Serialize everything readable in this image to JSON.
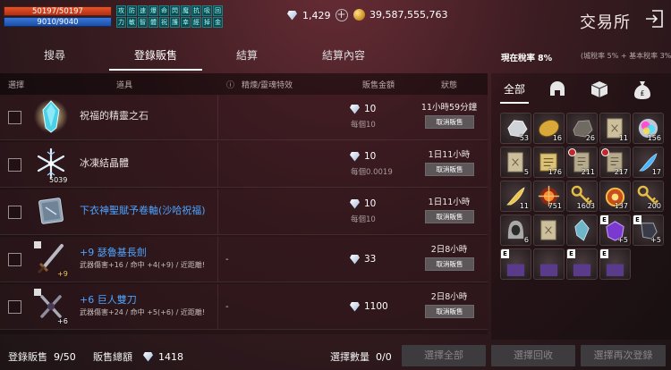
{
  "player": {
    "hp": "50197/50197",
    "mp": "9010/9040"
  },
  "buffs": [
    "攻",
    "防",
    "速",
    "爆",
    "命",
    "閃",
    "魔",
    "抗",
    "吸",
    "回",
    "力",
    "敏",
    "智",
    "體",
    "祝",
    "護",
    "幸",
    "經",
    "掉",
    "金"
  ],
  "currency": {
    "diamonds": "1,429",
    "gold": "39,587,555,763"
  },
  "shop": {
    "title": "交易所"
  },
  "tabs": [
    "搜尋",
    "登錄販售",
    "結算",
    "結算內容"
  ],
  "active_tab": "登錄販售",
  "tax": {
    "label": "現在稅率",
    "value": "8%",
    "detail": "(城稅率 5% + 基本稅率 3%)"
  },
  "table": {
    "headers": {
      "select": "選擇",
      "item": "道具",
      "refine": "精煉/靈魂特效",
      "price": "販售金額",
      "status": "狀態"
    },
    "rows": [
      {
        "name": "祝福的精靈之石",
        "name_color": "white",
        "qty": "",
        "refine": "",
        "price": "10",
        "unit": "每個10",
        "time": "11小時59分鐘",
        "action": "取消販售"
      },
      {
        "name": "冰凍結晶體",
        "name_color": "white",
        "qty": "5039",
        "refine": "",
        "price": "10",
        "unit": "每個0.0019",
        "time": "1日11小時",
        "action": "取消販售"
      },
      {
        "name": "下衣神聖賦予卷軸(沙哈祝福)",
        "name_color": "blue",
        "qty": "",
        "refine": "",
        "price": "10",
        "unit": "每個10",
        "time": "1日11小時",
        "action": "取消販售"
      },
      {
        "name": "+9 瑟魯基長劍",
        "name_color": "blue",
        "qty": "+9",
        "sub": "武器傷害+16 / 命中 +4(+9) / 近距離!",
        "refine": "-",
        "price": "33",
        "unit": "",
        "time": "2日8小時",
        "action": "取消販售"
      },
      {
        "name": "+6 巨人雙刀",
        "name_color": "blue",
        "qty": "+6",
        "sub": "武器傷害+24 / 命中 +5(+6) / 近距離!",
        "refine": "-",
        "price": "1100",
        "unit": "",
        "time": "2日8小時",
        "action": "取消販售"
      }
    ]
  },
  "footer": {
    "registered_label": "登錄販售",
    "registered_value": "9/50",
    "total_label": "販售總額",
    "total_value": "1418",
    "selected_label": "選擇數量",
    "selected_value": "0/0",
    "btn_select_all": "選擇全部",
    "btn_select_reclaim": "選擇回收",
    "btn_select_relist": "選擇再次登錄"
  },
  "inventory": {
    "tabs": [
      "全部",
      "helmet-icon",
      "box-icon",
      "money-bag-icon"
    ],
    "slots": [
      {
        "count": "53",
        "kind": "stone"
      },
      {
        "count": "16",
        "kind": "gold-ore"
      },
      {
        "count": "26",
        "kind": "dark-ore"
      },
      {
        "count": "11",
        "kind": "scroll"
      },
      {
        "count": "",
        "kind": "empty"
      },
      {
        "count": "156",
        "kind": "orb"
      },
      {
        "count": "5",
        "kind": "scroll"
      },
      {
        "count": "176",
        "kind": "scroll-gold"
      },
      {
        "count": "211",
        "kind": "scroll-ban"
      },
      {
        "count": "",
        "kind": "empty"
      },
      {
        "count": "217",
        "kind": "scroll-ban"
      },
      {
        "count": "17",
        "kind": "blue-feather"
      },
      {
        "count": "11",
        "kind": "gold-feather"
      },
      {
        "count": "751",
        "kind": "red-orb"
      },
      {
        "count": "",
        "kind": "empty"
      },
      {
        "count": "1603",
        "kind": "key"
      },
      {
        "count": "137",
        "kind": "amulet"
      },
      {
        "count": "200",
        "kind": "key"
      },
      {
        "count": "6",
        "kind": "hood"
      },
      {
        "count": "",
        "kind": "empty"
      },
      {
        "count": "",
        "kind": "scroll"
      },
      {
        "count": "",
        "kind": "crystal"
      },
      {
        "count": "+5",
        "kind": "purple-armor",
        "e": "E"
      },
      {
        "count": "+5",
        "kind": "dark-gauntlet",
        "e": "E"
      },
      {
        "count": "",
        "kind": "empty"
      },
      {
        "count": "",
        "kind": "partial",
        "e": "E"
      },
      {
        "count": "",
        "kind": "partial"
      },
      {
        "count": "",
        "kind": "partial",
        "e": "E"
      },
      {
        "count": "",
        "kind": "partial",
        "e": "E"
      },
      {
        "count": "",
        "kind": "empty"
      }
    ]
  }
}
